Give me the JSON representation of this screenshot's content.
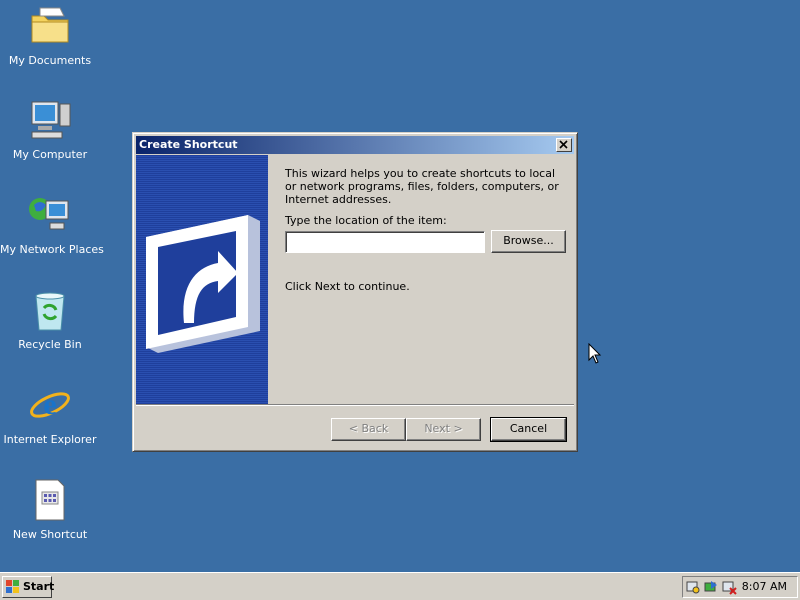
{
  "desktop": {
    "icons": [
      {
        "label": "My Documents",
        "icon": "folder-icon"
      },
      {
        "label": "My Computer",
        "icon": "computer-icon"
      },
      {
        "label": "My Network Places",
        "icon": "network-icon"
      },
      {
        "label": "Recycle Bin",
        "icon": "recycle-bin-icon"
      },
      {
        "label": "Internet Explorer",
        "icon": "ie-icon"
      },
      {
        "label": "New Shortcut",
        "icon": "shortcut-icon"
      }
    ],
    "background_color": "#3a6ea5"
  },
  "dialog": {
    "title": "Create Shortcut",
    "close_symbol": "×",
    "description": "This wizard helps you to create shortcuts to local or network programs, files, folders, computers, or Internet addresses.",
    "location_label": "Type the location of the item:",
    "location_value": "",
    "browse_label": "Browse...",
    "continue_text": "Click Next to continue.",
    "back_label": "< Back",
    "next_label": "Next >",
    "cancel_label": "Cancel"
  },
  "taskbar": {
    "start_label": "Start",
    "clock": "8:07 AM",
    "tray_icons": [
      "tray-icon-1",
      "tray-icon-2",
      "tray-icon-3"
    ]
  }
}
